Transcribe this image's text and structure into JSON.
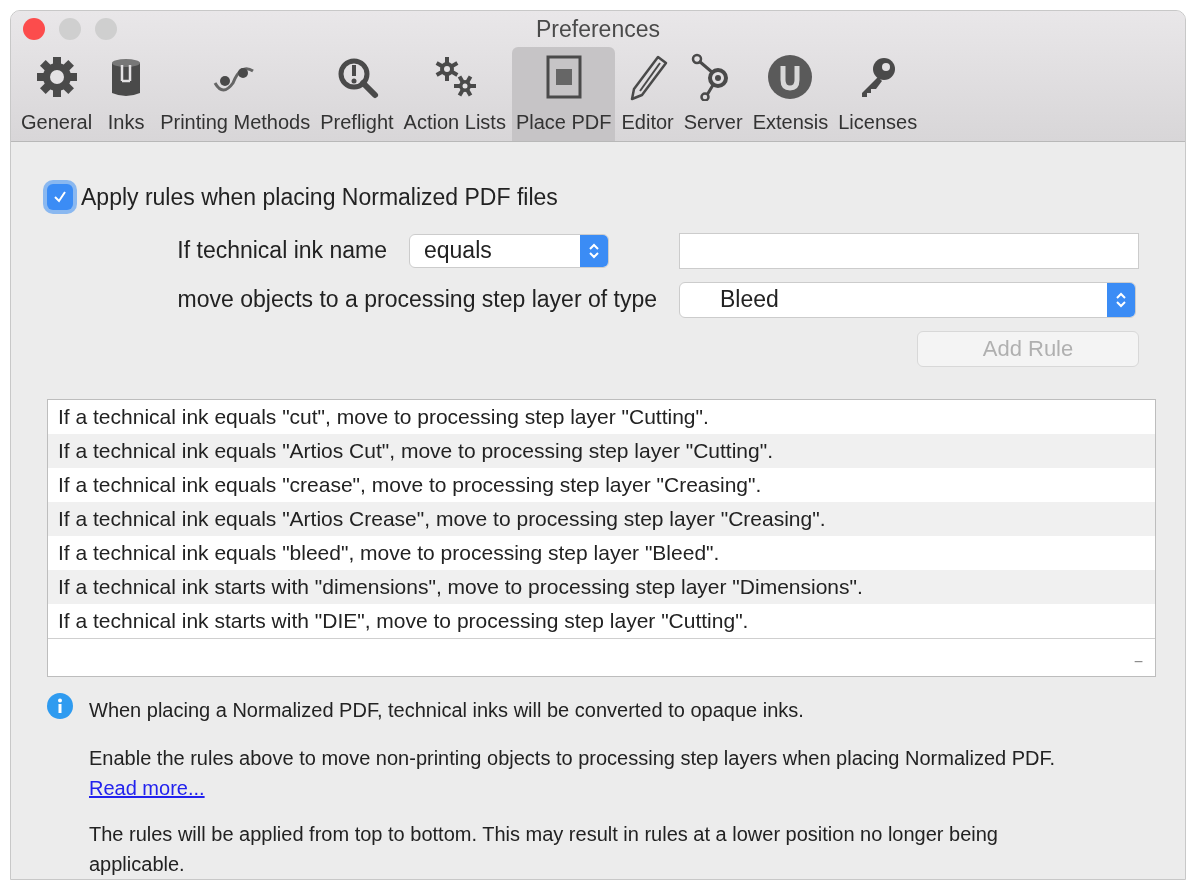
{
  "window": {
    "title": "Preferences"
  },
  "tabs": [
    {
      "label": "General",
      "selected": false
    },
    {
      "label": "Inks",
      "selected": false
    },
    {
      "label": "Printing Methods",
      "selected": false
    },
    {
      "label": "Preflight",
      "selected": false
    },
    {
      "label": "Action Lists",
      "selected": false
    },
    {
      "label": "Place PDF",
      "selected": true
    },
    {
      "label": "Editor",
      "selected": false
    },
    {
      "label": "Server",
      "selected": false
    },
    {
      "label": "Extensis",
      "selected": false
    },
    {
      "label": "Licenses",
      "selected": false
    }
  ],
  "apply_rules": {
    "label": "Apply rules when placing Normalized PDF files",
    "checked": true
  },
  "condition": {
    "label": "If technical ink name",
    "operator": "equals"
  },
  "target": {
    "label": "move objects to a processing step layer of type",
    "layer": "Bleed"
  },
  "add_rule": {
    "label": "Add Rule",
    "disabled": true
  },
  "rules": [
    {
      "text": "If a technical ink equals \"cut\", move to processing step layer \"Cutting\"."
    },
    {
      "text": "If a technical ink equals \"Artios Cut\", move to processing step layer \"Cutting\"."
    },
    {
      "text": "If a technical ink equals \"crease\", move to processing step layer \"Creasing\"."
    },
    {
      "text": "If a technical ink equals \"Artios Crease\", move to processing step layer \"Creasing\"."
    },
    {
      "text": "If a technical ink equals \"bleed\", move to processing step layer \"Bleed\"."
    },
    {
      "text": "If a technical ink starts with \"dimensions\", move to processing step layer \"Dimensions\"."
    },
    {
      "text": "If a technical ink starts with \"DIE\", move to processing step layer \"Cutting\"."
    }
  ],
  "remove_button": "−",
  "info": {
    "note": "When placing a Normalized PDF, technical inks will be converted to opaque inks.",
    "explanation": "Enable the rules above to move non-printing objects to processing step layers when placing Normalized PDF.",
    "link": "Read more...",
    "order_note": "The rules will be applied from top to bottom. This may result in rules at a lower position no longer being applicable."
  }
}
